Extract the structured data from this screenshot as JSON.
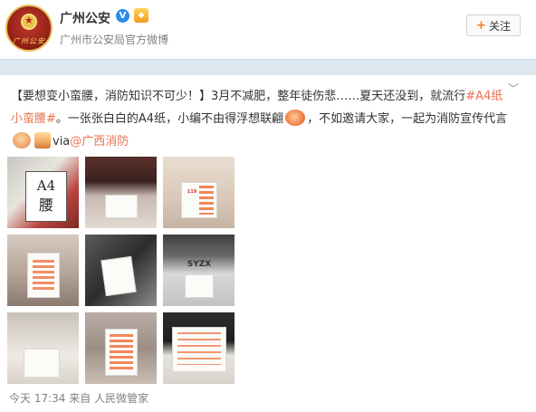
{
  "header": {
    "account_name": "广州公安",
    "verified_badge": "V",
    "subtitle": "广州市公安局官方微博",
    "avatar_text": "广州公安",
    "follow_label": "关注",
    "follow_icon": "plus-icon"
  },
  "post": {
    "seg1": "【要想变小蛮腰，消防知识不可少！】3月不减肥，整年徒伤悲……夏天还没到，就流行",
    "hashtag": "#A4纸小蛮腰#",
    "seg2": "。一张张白白的A4纸，小编不由得浮想联翩",
    "seg3": "，不如邀请大家，一起为消防宣传代言",
    "seg4": "via",
    "mention": "@广西消防",
    "expand_icon": "chevron-down-icon"
  },
  "photos": [
    {
      "name": "photo-1",
      "paper_text_1": "A4",
      "paper_text_2": "腰"
    },
    {
      "name": "photo-2",
      "paper_text": ""
    },
    {
      "name": "photo-3",
      "paper_text": "119"
    },
    {
      "name": "photo-4",
      "paper_text": ""
    },
    {
      "name": "photo-5",
      "paper_text": ""
    },
    {
      "name": "photo-6",
      "paper_text": "SYZX"
    },
    {
      "name": "photo-7",
      "paper_text": ""
    },
    {
      "name": "photo-8",
      "paper_text": ""
    },
    {
      "name": "photo-9",
      "paper_text": ""
    }
  ],
  "footer": {
    "time": "今天 17:34",
    "via_prefix": "来自",
    "source": "人民微管家"
  },
  "colors": {
    "link": "#eb7350",
    "separator": "#dde8f0",
    "verified": "#2f8be8"
  }
}
